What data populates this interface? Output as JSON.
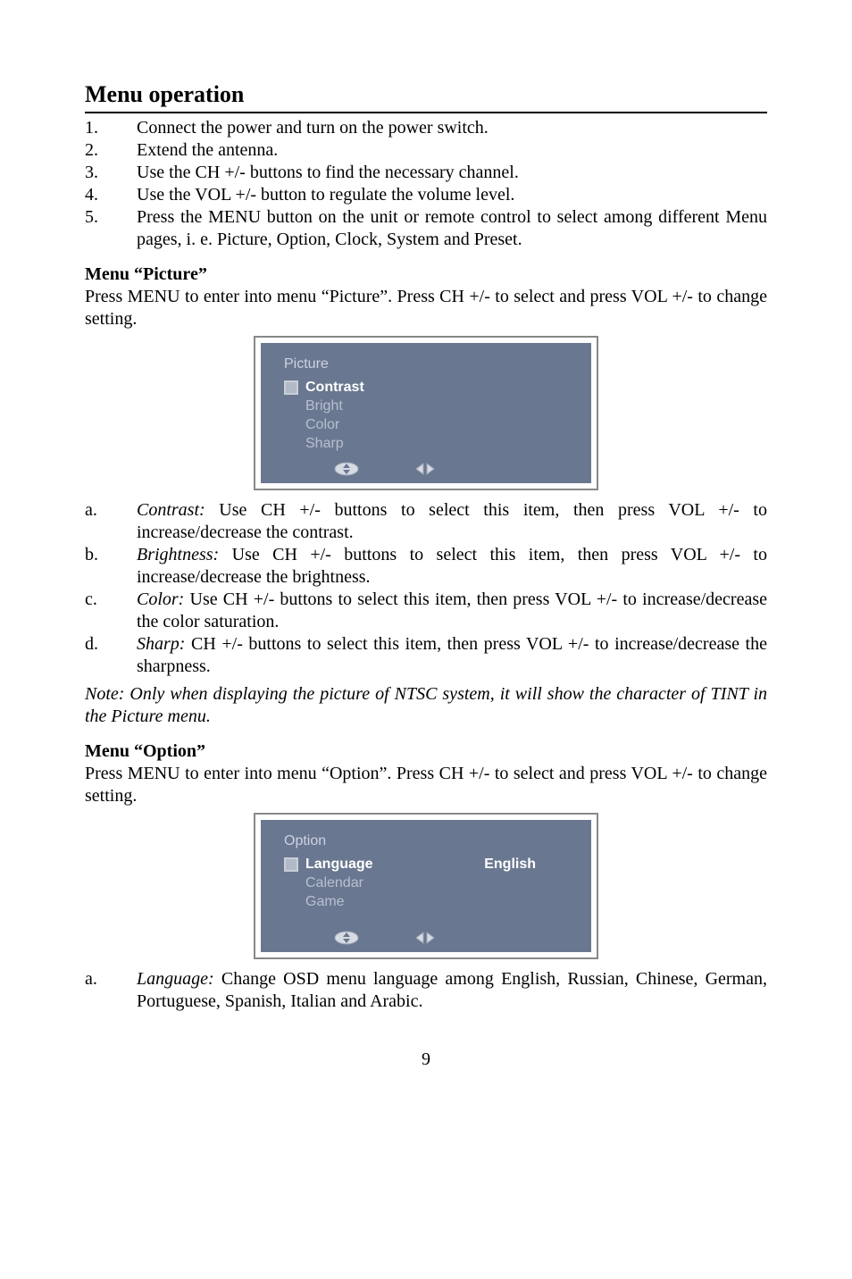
{
  "heading": "Menu operation",
  "steps": [
    {
      "n": "1.",
      "t": "Connect the power and turn on the power switch."
    },
    {
      "n": "2.",
      "t": "Extend the antenna."
    },
    {
      "n": "3.",
      "t": "Use the CH +/- buttons to find the necessary channel."
    },
    {
      "n": "4.",
      "t": "Use the VOL +/- button to regulate the volume level."
    },
    {
      "n": "5.",
      "t": "Press the MENU button on the unit or remote control to select among different Menu pages, i. e. Picture, Option, Clock, System and Preset."
    }
  ],
  "picture": {
    "title": "Menu “Picture”",
    "intro": "Press MENU to enter into menu “Picture”. Press CH +/- to select and press VOL +/- to change setting.",
    "menu": {
      "name": "Picture",
      "items": [
        {
          "label": "Contrast",
          "selected": true
        },
        {
          "label": "Bright",
          "selected": false
        },
        {
          "label": "Color",
          "selected": false
        },
        {
          "label": "Sharp",
          "selected": false
        }
      ]
    },
    "letters": [
      {
        "l": "a.",
        "name": "Contrast:",
        "t": " Use CH +/- buttons to select this item, then press VOL +/- to increase/decrease the contrast."
      },
      {
        "l": "b.",
        "name": "Brightness:",
        "t": " Use CH +/- buttons to select this item, then press VOL +/- to increase/decrease the brightness."
      },
      {
        "l": "c.",
        "name": "Color:",
        "t": " Use CH +/- buttons to select this item, then press VOL +/- to increase/decrease the color saturation."
      },
      {
        "l": "d.",
        "name": "Sharp:",
        "t": " CH +/- buttons to select this item, then press VOL +/- to increase/decrease the sharpness."
      }
    ],
    "note": "Note: Only when displaying the picture of NTSC system, it will show the character of TINT in the Picture menu."
  },
  "option": {
    "title": "Menu “Option”",
    "intro": "Press MENU to enter into menu “Option”. Press CH +/- to select and press VOL +/- to change setting.",
    "menu": {
      "name": "Option",
      "items": [
        {
          "label": "Language",
          "selected": true,
          "value": "English"
        },
        {
          "label": "Calendar",
          "selected": false
        },
        {
          "label": "Game",
          "selected": false
        }
      ]
    },
    "letters": [
      {
        "l": "a.",
        "name": "Language:",
        "t": " Change OSD menu language among English, Russian, Chinese, German, Portuguese, Spanish, Italian and Arabic."
      }
    ]
  },
  "page_number": "9"
}
